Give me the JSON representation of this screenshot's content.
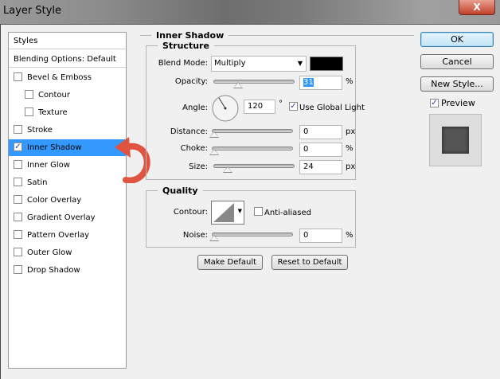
{
  "window": {
    "title": "Layer Style",
    "close_label": "X"
  },
  "styles_panel": {
    "header": "Styles",
    "blending": "Blending Options: Default",
    "items": [
      {
        "label": "Bevel & Emboss",
        "checked": false,
        "indent": false
      },
      {
        "label": "Contour",
        "checked": false,
        "indent": true
      },
      {
        "label": "Texture",
        "checked": false,
        "indent": true
      },
      {
        "label": "Stroke",
        "checked": false,
        "indent": false
      },
      {
        "label": "Inner Shadow",
        "checked": true,
        "indent": false,
        "selected": true
      },
      {
        "label": "Inner Glow",
        "checked": false,
        "indent": false
      },
      {
        "label": "Satin",
        "checked": false,
        "indent": false
      },
      {
        "label": "Color Overlay",
        "checked": false,
        "indent": false
      },
      {
        "label": "Gradient Overlay",
        "checked": false,
        "indent": false
      },
      {
        "label": "Pattern Overlay",
        "checked": false,
        "indent": false
      },
      {
        "label": "Outer Glow",
        "checked": false,
        "indent": false
      },
      {
        "label": "Drop Shadow",
        "checked": false,
        "indent": false
      }
    ]
  },
  "inner_shadow": {
    "title": "Inner Shadow",
    "structure": {
      "title": "Structure",
      "blend_mode_label": "Blend Mode:",
      "blend_mode": "Multiply",
      "color": "#000000",
      "opacity_label": "Opacity:",
      "opacity": "31",
      "opacity_unit": "%",
      "angle_label": "Angle:",
      "angle": "120",
      "angle_unit": "°",
      "use_global_light": "Use Global Light",
      "distance_label": "Distance:",
      "distance": "0",
      "distance_unit": "px",
      "choke_label": "Choke:",
      "choke": "0",
      "choke_unit": "%",
      "size_label": "Size:",
      "size": "24",
      "size_unit": "px"
    },
    "quality": {
      "title": "Quality",
      "contour_label": "Contour:",
      "anti_aliased": "Anti-aliased",
      "noise_label": "Noise:",
      "noise": "0",
      "noise_unit": "%"
    },
    "make_default": "Make Default",
    "reset_default": "Reset to Default"
  },
  "buttons": {
    "ok": "OK",
    "cancel": "Cancel",
    "new_style": "New Style...",
    "preview": "Preview"
  },
  "colors": {
    "selection": "#3399ff",
    "arrow": "#e0533f"
  }
}
